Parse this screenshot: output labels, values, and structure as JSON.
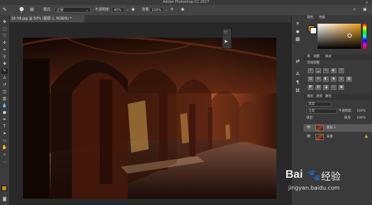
{
  "app_title": "Adobe Photoshop CC 2017",
  "options_bar": {
    "brush_size": "1",
    "mode_label": "模式:",
    "mode_value": "正常",
    "opacity_label": "不透明度:",
    "opacity_value": "40%",
    "flow_label": "流量:",
    "flow_value": "100%"
  },
  "document_tab": "16-58.jpg @ 50% (图层 1, RGB/8) *",
  "right_panel": {
    "swatch_tabs": [
      "颜色",
      "色板"
    ],
    "library_tabs": [
      "库",
      "调整",
      "样式"
    ],
    "adjust_header": "添加调整",
    "layers_tabs": [
      "图层",
      "通道",
      "路径"
    ],
    "filter_label": "类型",
    "blend_mode": "正常",
    "opacity_label": "不透明度:",
    "opacity_value": "100%",
    "lock_label": "锁定:",
    "fill_label": "填充:",
    "fill_value": "100%",
    "layers": [
      {
        "name": "图层 1"
      },
      {
        "name": "背景"
      }
    ]
  },
  "watermark": {
    "brand": "Bai",
    "brand2": "经验",
    "url": "jingyan.baidu.com"
  },
  "colors": {
    "accent": "#f07830",
    "foreground_swatch": "#c88a1c",
    "canvas_bg": "#282828"
  }
}
